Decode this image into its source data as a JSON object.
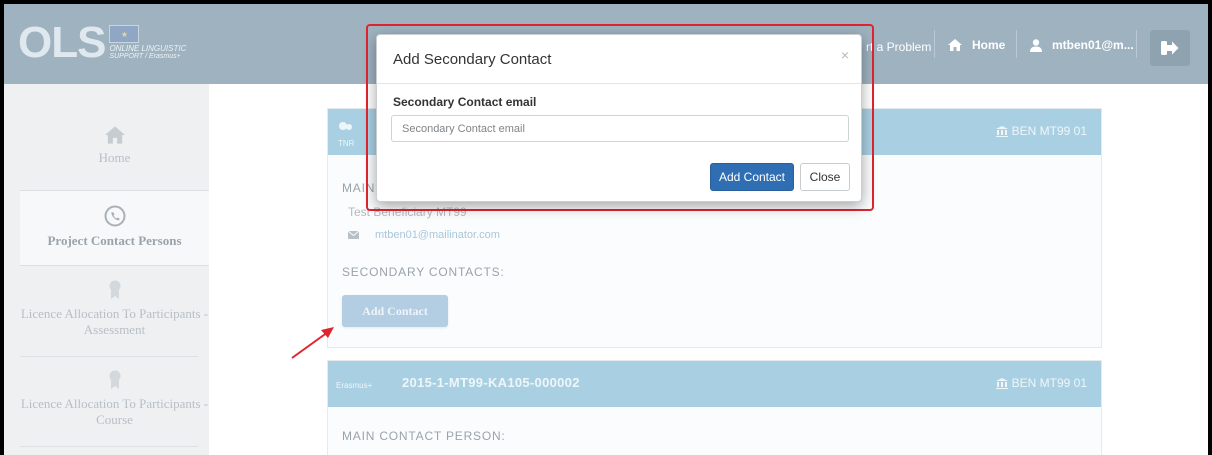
{
  "header": {
    "logo_big": "OLS",
    "logo_line1": "ONLINE LINGUISTIC",
    "logo_line2": "SUPPORT / Erasmus+",
    "report_link": "rt a Problem",
    "home_label": "Home",
    "user_label": "mtben01@m..."
  },
  "sidebar": {
    "items": [
      {
        "label": "Home",
        "icon": "home-icon"
      },
      {
        "label": "Project Contact Persons",
        "icon": "phone-icon"
      },
      {
        "label": "Licence Allocation To Participants - Assessment",
        "icon": "award-icon"
      },
      {
        "label": "Licence Allocation To Participants - Course",
        "icon": "award-icon"
      }
    ]
  },
  "cards": [
    {
      "program_logo": "TNR",
      "code": "",
      "beneficiary": "BEN MT99 01",
      "main_contact_label": "MAIN C",
      "person_name": "Test Beneficiary MT99",
      "person_email": "mtben01@mailinator.com",
      "secondary_label": "SECONDARY CONTACTS:",
      "add_contact": "Add Contact"
    },
    {
      "program_logo": "Erasmus+",
      "code": "2015-1-MT99-KA105-000002",
      "beneficiary": "BEN MT99 01",
      "main_contact_label": "MAIN CONTACT PERSON:"
    }
  ],
  "modal": {
    "title": "Add Secondary Contact",
    "close_symbol": "×",
    "field_label": "Secondary Contact email",
    "field_placeholder": "Secondary Contact email",
    "field_value": "",
    "add_button": "Add Contact",
    "close_button": "Close"
  },
  "colors": {
    "topbar": "#9fb2c0",
    "card_header": "#a9d0e2",
    "primary_button": "#2f6eb3",
    "highlight": "#e0242e"
  }
}
